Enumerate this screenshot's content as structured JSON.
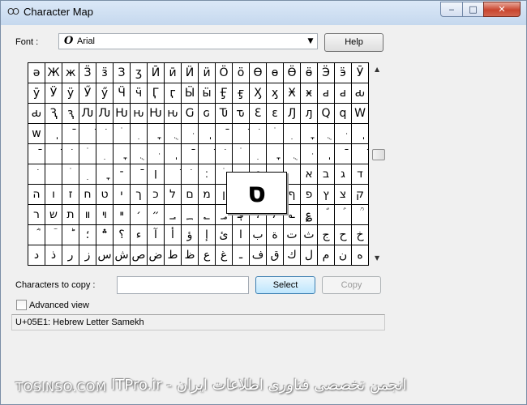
{
  "window": {
    "title": "Character Map",
    "app_icon": "charmap-icon"
  },
  "titlebar": {
    "minimize": "‒",
    "maximize": "□",
    "close": "✕"
  },
  "font": {
    "label": "Font :",
    "icon_glyph": "O",
    "value": "Arial"
  },
  "help_label": "Help",
  "grid": {
    "rows": [
      [
        "ə",
        "Ж",
        "ж",
        "Ӟ",
        "ӟ",
        "З",
        "ʒ",
        "Ӣ",
        "ӣ",
        "Ӥ",
        "ӥ",
        "Ӧ",
        "ӧ",
        "Ө",
        "ө",
        "Ӫ",
        "ӫ",
        "Ӭ",
        "ӭ",
        "Ӯ"
      ],
      [
        "ӯ",
        "Ӱ",
        "ӱ",
        "Ӳ",
        "ӳ",
        "Ӵ",
        "ӵ",
        "Ӷ",
        "ӷ",
        "Ӹ",
        "ӹ",
        "Ӻ",
        "ӻ",
        "Ӽ",
        "ӽ",
        "Ӿ",
        "ӿ",
        "ԁ",
        "ԁ",
        "ԃ"
      ],
      [
        "ԃ",
        "Ԇ",
        "ԇ",
        "Ԉ",
        "Ԉ",
        "Ԋ",
        "ԋ",
        "Ԋ",
        "ԋ",
        "Ԍ",
        "ԍ",
        "Ԏ",
        "ԏ",
        "Ɛ",
        "ɛ",
        "Ԓ",
        "ԓ",
        "Ԛ",
        "ԛ",
        "Ԝ"
      ],
      [
        "ԝ",
        "ֽ",
        "ֿ",
        "ׁ",
        "ׂ",
        "ׄ",
        "ׅ",
        "ׇ",
        "ֻ",
        "ּ",
        "ֽ",
        "ֿ",
        "ׁ",
        "ׂ",
        "ׄ",
        "ׅ",
        "ׇ",
        "ֻ",
        "ּ",
        "ֽ"
      ],
      [
        "ֿ",
        "ׁ",
        "ׂ",
        "ׄ",
        "ׅ",
        "ׇ",
        "ֻ",
        "ּ",
        "ֽ",
        "ֿ",
        "ׁ",
        "ׂ",
        "ׄ",
        "ׅ",
        "ׇ",
        "ֻ",
        "ּ",
        "ֽ",
        "ֿ",
        "ׁ"
      ],
      [
        "ׂ",
        "",
        "ׄ",
        "ׅ",
        "ׇ",
        "־",
        "ֿ",
        "׀",
        "ׁ",
        "ׂ",
        "׃",
        "ׄ",
        "ׅ",
        "׆",
        "ׇ",
        "",
        "א",
        "ב",
        "ג",
        "ד"
      ],
      [
        "ה",
        "ו",
        "ז",
        "ח",
        "ט",
        "י",
        "ך",
        "כ",
        "ל",
        "ם",
        "מ",
        "ן",
        "נ",
        "ס",
        "ע",
        "ף",
        "פ",
        "ץ",
        "צ",
        "ק"
      ],
      [
        "ר",
        "ש",
        "ת",
        "װ",
        "ױ",
        "ײ",
        "׳",
        "״",
        "؀",
        "؁",
        "؂",
        "؃",
        "؋",
        "،",
        "؍",
        "؎",
        "؏",
        "ؐ",
        "ؑ",
        "ؒ"
      ],
      [
        "ؓ",
        "ؔ",
        "ؕ",
        "؛",
        "؞",
        "؟",
        "ء",
        "آ",
        "أ",
        "ؤ",
        "إ",
        "ئ",
        "ا",
        "ب",
        "ة",
        "ت",
        "ث",
        "ج",
        "ح",
        "خ"
      ],
      [
        "د",
        "ذ",
        "ر",
        "ز",
        "س",
        "ش",
        "ص",
        "ض",
        "ط",
        "ظ",
        "ع",
        "غ",
        "ـ",
        "ف",
        "ق",
        "ك",
        "ل",
        "م",
        "ن",
        "ه"
      ]
    ]
  },
  "magnified_char": "ס",
  "copy": {
    "label": "Characters to copy :",
    "value": "",
    "select_label": "Select",
    "copy_label": "Copy"
  },
  "advanced": {
    "label": "Advanced view",
    "checked": false
  },
  "status": "U+05E1: Hebrew Letter Samekh",
  "watermark": {
    "left": "TOSINSO.COM",
    "right": "ITPro.ir - انجمن تخصصی فناوری اطلاعات ایران"
  }
}
